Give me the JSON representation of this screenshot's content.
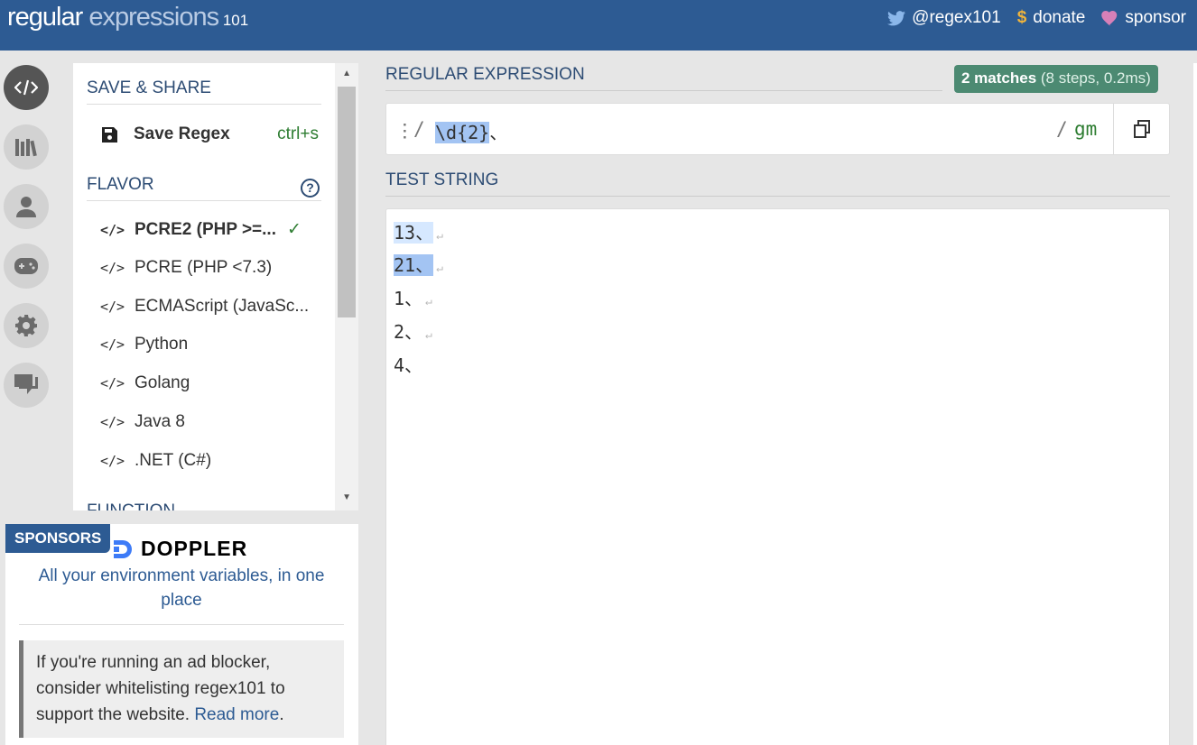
{
  "header": {
    "logo_part1": "regular",
    "logo_part2": " expressions",
    "logo_part3": " 101",
    "links": [
      {
        "icon": "twitter-icon",
        "label": "@regex101"
      },
      {
        "icon": "dollar-icon",
        "label": "donate"
      },
      {
        "icon": "heart-icon",
        "label": "sponsor"
      }
    ]
  },
  "rail": [
    "regex-editor-icon",
    "library-icon",
    "account-icon",
    "quiz-icon",
    "settings-icon",
    "community-icon"
  ],
  "panel": {
    "save_share_title": "SAVE & SHARE",
    "save_label": "Save Regex",
    "save_shortcut": "ctrl+s",
    "flavor_title": "FLAVOR",
    "help_label": "?",
    "flavors": [
      {
        "label": "PCRE2 (PHP >=...",
        "selected": true
      },
      {
        "label": "PCRE (PHP <7.3)"
      },
      {
        "label": "ECMAScript (JavaSc..."
      },
      {
        "label": "Python"
      },
      {
        "label": "Golang"
      },
      {
        "label": "Java 8"
      },
      {
        "label": ".NET (C#)"
      }
    ],
    "flavor_tag": "</>",
    "function_title": "FUNCTION"
  },
  "sponsors": {
    "tag": "SPONSORS",
    "brand": "DOPPLER",
    "tagline": "All your environment variables, in one place",
    "adblock_text": "If you're running an ad blocker, consider whitelisting regex101 to support the website. ",
    "adblock_link": "Read more",
    "adblock_end": "."
  },
  "regex": {
    "title": "REGULAR EXPRESSION",
    "matches_bold": "2 matches",
    "matches_detail": " (8 steps, 0.2ms)",
    "delim_open": "/",
    "pattern": "\\d{2}",
    "pattern_tail": "、",
    "delim_close": "/",
    "flags": "gm"
  },
  "test": {
    "title": "TEST STRING",
    "lines": [
      {
        "text": "13、",
        "match": "m1"
      },
      {
        "text": "21、",
        "match": "m2"
      },
      {
        "text": "1、",
        "match": ""
      },
      {
        "text": "2、",
        "match": ""
      },
      {
        "text": "4、",
        "match": ""
      }
    ]
  },
  "colors": {
    "header_bg": "#2d5b93",
    "match_badge": "#4c8a72",
    "match_highlight_1": "#d6e8ff",
    "match_highlight_2": "#a3c4f3"
  }
}
